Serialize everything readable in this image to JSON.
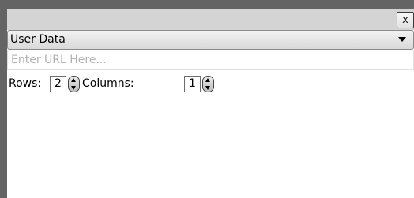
{
  "titlebar": {
    "close_label": "x"
  },
  "source_select": {
    "selected": "User Data"
  },
  "url_input": {
    "value": "",
    "placeholder": "Enter URL Here..."
  },
  "grid": {
    "rows_label": "Rows:",
    "rows_value": "2",
    "columns_label": "Columns:",
    "columns_value": "1"
  },
  "icons": {
    "close": "close-icon",
    "dropdown": "chevron-down-icon",
    "spin_up": "arrow-up-icon",
    "spin_down": "arrow-down-icon"
  }
}
